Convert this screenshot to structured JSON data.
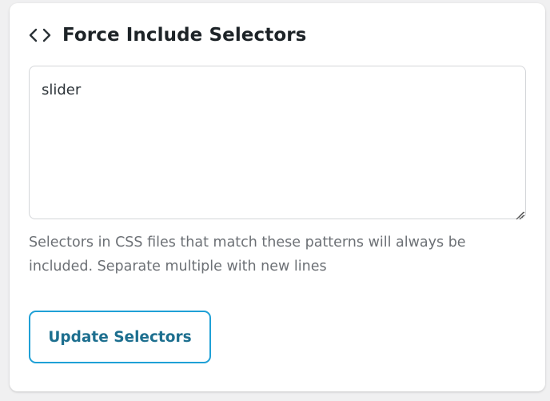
{
  "panel": {
    "title": "Force Include Selectors",
    "icon": "code-icon"
  },
  "selectors_input": {
    "value": "slider"
  },
  "help_text": "Selectors in CSS files that match these patterns will always be included. Separate multiple with new lines",
  "update_button": {
    "label": "Update Selectors"
  },
  "colors": {
    "accent_border": "#1fa0d6",
    "button_text": "#1d6f8f",
    "title_text": "#1d2327",
    "help_text": "#6c7075"
  }
}
